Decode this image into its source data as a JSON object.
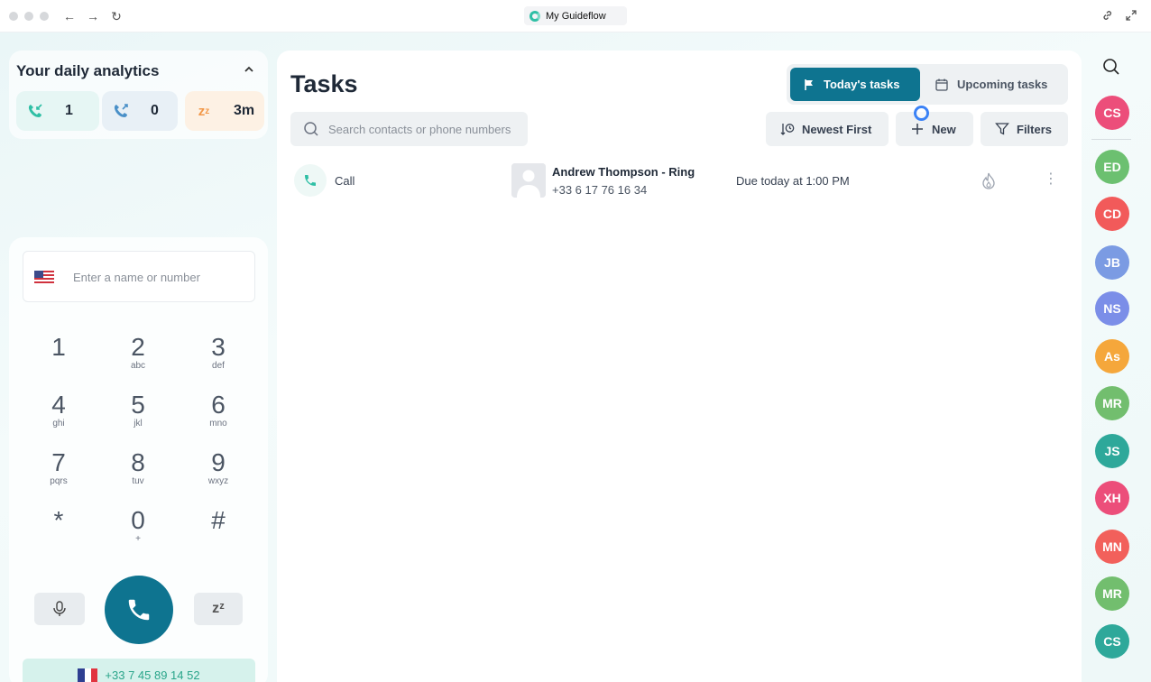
{
  "browser": {
    "tab_title": "My Guideflow"
  },
  "analytics": {
    "title": "Your daily analytics",
    "stats": [
      {
        "icon": "incoming-call-icon",
        "value": "1",
        "bg": "#e6f6f4",
        "color": "#2fbfa5"
      },
      {
        "icon": "outgoing-call-icon",
        "value": "0",
        "bg": "#e8f0f6",
        "color": "#4a90c8"
      },
      {
        "icon": "snooze-icon",
        "value": "3m",
        "bg": "#fdf1e4",
        "color": "#f2994a"
      }
    ]
  },
  "dialer": {
    "placeholder": "Enter a name or number",
    "keys": [
      {
        "digit": "1",
        "letters": ""
      },
      {
        "digit": "2",
        "letters": "abc"
      },
      {
        "digit": "3",
        "letters": "def"
      },
      {
        "digit": "4",
        "letters": "ghi"
      },
      {
        "digit": "5",
        "letters": "jkl"
      },
      {
        "digit": "6",
        "letters": "mno"
      },
      {
        "digit": "7",
        "letters": "pqrs"
      },
      {
        "digit": "8",
        "letters": "tuv"
      },
      {
        "digit": "9",
        "letters": "wxyz"
      },
      {
        "digit": "*",
        "letters": ""
      },
      {
        "digit": "0",
        "letters": "+"
      },
      {
        "digit": "#",
        "letters": ""
      }
    ],
    "snooze_label": "zᶻ",
    "caller_id": "+33 7 45 89 14 52"
  },
  "tasks": {
    "title": "Tasks",
    "tabs": {
      "today": "Today's tasks",
      "upcoming": "Upcoming tasks"
    },
    "search_placeholder": "Search contacts or phone numbers",
    "sort_label": "Newest First",
    "new_label": "New",
    "filters_label": "Filters",
    "rows": [
      {
        "type": "Call",
        "name": "Andrew Thompson - Ring",
        "phone": "+33 6 17 76 16 34",
        "due": "Due today at 1:00 PM"
      }
    ]
  },
  "contacts": [
    {
      "initials": "CS",
      "color": "#ec4e7a"
    },
    {
      "initials": "ED",
      "color": "#6cc070"
    },
    {
      "initials": "CD",
      "color": "#f25a5a"
    },
    {
      "initials": "JB",
      "color": "#7b9be3"
    },
    {
      "initials": "NS",
      "color": "#7b8ee8"
    },
    {
      "initials": "As",
      "color": "#f5a73b"
    },
    {
      "initials": "MR",
      "color": "#72be6e"
    },
    {
      "initials": "JS",
      "color": "#2ea89a"
    },
    {
      "initials": "XH",
      "color": "#ec4e7a"
    },
    {
      "initials": "MN",
      "color": "#f2605b"
    },
    {
      "initials": "MR",
      "color": "#72be6e"
    },
    {
      "initials": "CS",
      "color": "#2ea89a"
    }
  ],
  "colors": {
    "accent": "#0e7490",
    "call_green": "#2fbfa5"
  }
}
